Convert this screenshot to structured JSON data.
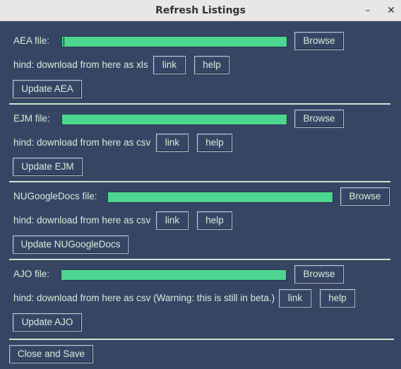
{
  "window": {
    "title": "Refresh Listings"
  },
  "sections": [
    {
      "file_label": "AEA file:",
      "file_value": "",
      "browse_label": "Browse",
      "hint": "hind: download from here as xls",
      "link_label": "link",
      "help_label": "help",
      "update_label": "Update AEA"
    },
    {
      "file_label": "EJM file:",
      "file_value": "",
      "browse_label": "Browse",
      "hint": "hind: download from here as csv",
      "link_label": "link",
      "help_label": "help",
      "update_label": "Update EJM"
    },
    {
      "file_label": "NUGoogleDocs file:",
      "file_value": "",
      "browse_label": "Browse",
      "hint": "hind: download from here as csv",
      "link_label": "link",
      "help_label": "help",
      "update_label": "Update NUGoogleDocs"
    },
    {
      "file_label": "AJO file:",
      "file_value": "",
      "browse_label": "Browse",
      "hint": "hind: download from here as csv (Warning: this is still in beta.)",
      "link_label": "link",
      "help_label": "help",
      "update_label": "Update AJO"
    }
  ],
  "footer": {
    "close_save_label": "Close and Save"
  },
  "colors": {
    "background": "#374565",
    "text": "#d3eed9",
    "field": "#4cd68f",
    "separator": "#c6e6cf"
  }
}
